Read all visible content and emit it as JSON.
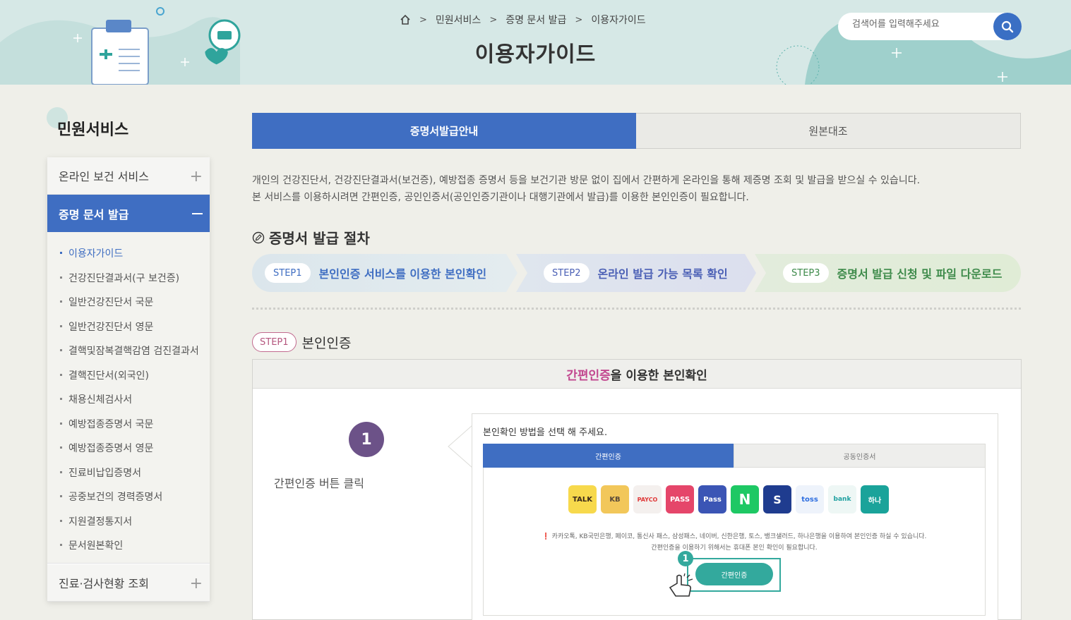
{
  "header": {
    "breadcrumb": [
      "민원서비스",
      "증명 문서 발급",
      "이용자가이드"
    ],
    "title": "이용자가이드",
    "search_placeholder": "검색어를 입력해주세요"
  },
  "sidebar": {
    "title": "민원서비스",
    "menus": [
      {
        "label": "온라인 보건 서비스"
      },
      {
        "label": "증명 문서 발급"
      },
      {
        "label": "진료·검사현황 조회"
      }
    ],
    "submenu": [
      "이용자가이드",
      "건강진단결과서(구 보건증)",
      "일반건강진단서 국문",
      "일반건강진단서 영문",
      "결핵및잠복결핵감염 검진결과서",
      "결핵진단서(외국인)",
      "채용신체검사서",
      "예방접종증명서 국문",
      "예방접종증명서 영문",
      "진료비납입증명서",
      "공중보건의 경력증명서",
      "지원결정통지서",
      "문서원본확인"
    ]
  },
  "tabs": [
    "증명서발급안내",
    "원본대조"
  ],
  "intro": [
    "개인의 건강진단서, 건강진단결과서(보건증), 예방접종 증명서 등을 보건기관 방문 없이 집에서 간편하게 온라인을 통해 제증명 조회 및 발급을 받으실 수 있습니다.",
    "본 서비스를 이용하시려면 간편인증, 공인인증서(공인인증기관이나 대행기관에서 발급)를 이용한 본인인증이 필요합니다."
  ],
  "procedure": {
    "title": "증명서 발급 절차",
    "steps": [
      {
        "badge": "STEP1",
        "text": "본인인증 서비스를 이용한 본인확인",
        "color": "#3f6ec2"
      },
      {
        "badge": "STEP2",
        "text": "온라인 발급 가능 목록 확인",
        "color": "#4a5fb5"
      },
      {
        "badge": "STEP3",
        "text": "증명서 발급 신청 및 파일 다운로드",
        "color": "#3d8a4a"
      }
    ]
  },
  "step1": {
    "badge": "STEP1",
    "title": "본인인증",
    "box_title_highlight": "간편인증",
    "box_title_rest": "을 이용한 본인확인",
    "number": "1",
    "caption": "간편인증 버튼 클릭",
    "mock": {
      "question": "본인확인 방법을 선택 해 주세요.",
      "tabs": [
        "간편인증",
        "공동인증서"
      ],
      "providers": [
        {
          "label": "TALK",
          "bg": "#f7d94c",
          "fg": "#3b2a1a"
        },
        {
          "label": "KB",
          "bg": "#f2c75a",
          "fg": "#5a4a3a"
        },
        {
          "label": "PAYCO",
          "bg": "#f4f0ee",
          "fg": "#e03a3a"
        },
        {
          "label": "PASS",
          "bg": "#e5466a",
          "fg": "#ffffff"
        },
        {
          "label": "Pass",
          "bg": "#3b55b5",
          "fg": "#ffffff"
        },
        {
          "label": "N",
          "bg": "#1ec864",
          "fg": "#ffffff"
        },
        {
          "label": "S",
          "bg": "#1f3c8f",
          "fg": "#ffffff"
        },
        {
          "label": "toss",
          "bg": "#eef3fb",
          "fg": "#2f6fe0"
        },
        {
          "label": "bank",
          "bg": "#eef7f5",
          "fg": "#1ea0a0"
        },
        {
          "label": "하나",
          "bg": "#1aa39a",
          "fg": "#ffffff"
        }
      ],
      "note1": "카카오톡, KB국민은행, 페이코, 통신사 패스, 삼성패스, 네이버, 신한은행, 토스, 뱅크샐러드, 하나은행을 이용하여 본인인증 하실 수 있습니다.",
      "note2": "간편인증을 이용하기 위해서는 휴대폰 본인 확인이 필요합니다.",
      "button": "간편인증",
      "mark": "1"
    }
  }
}
